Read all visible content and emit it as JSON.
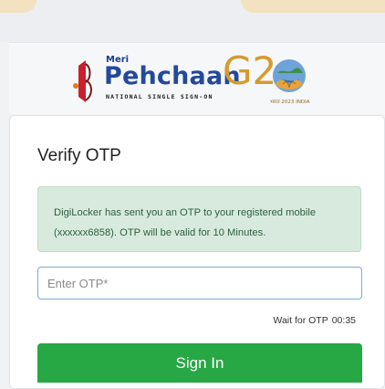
{
  "header": {
    "brand": {
      "prefix": "Meri",
      "name": "Pehchaan",
      "tagline": "NATIONAL SINGLE SIGN-ON",
      "g20_text": "G2",
      "g20_sub": "भारत 2023 INDIA"
    }
  },
  "form": {
    "title": "Verify OTP",
    "alert_message": "DigiLocker has sent you an OTP to your registered mobile (xxxxxx6858). OTP will be valid for 10 Minutes.",
    "otp_placeholder": "Enter OTP*",
    "wait_label": "Wait for OTP",
    "wait_timer": "00:35",
    "submit_label": "Sign In"
  },
  "colors": {
    "accent_green": "#28a745",
    "alert_bg": "#d8eadd",
    "brand_blue": "#234a9a",
    "g20_gold": "#d79a2d"
  }
}
